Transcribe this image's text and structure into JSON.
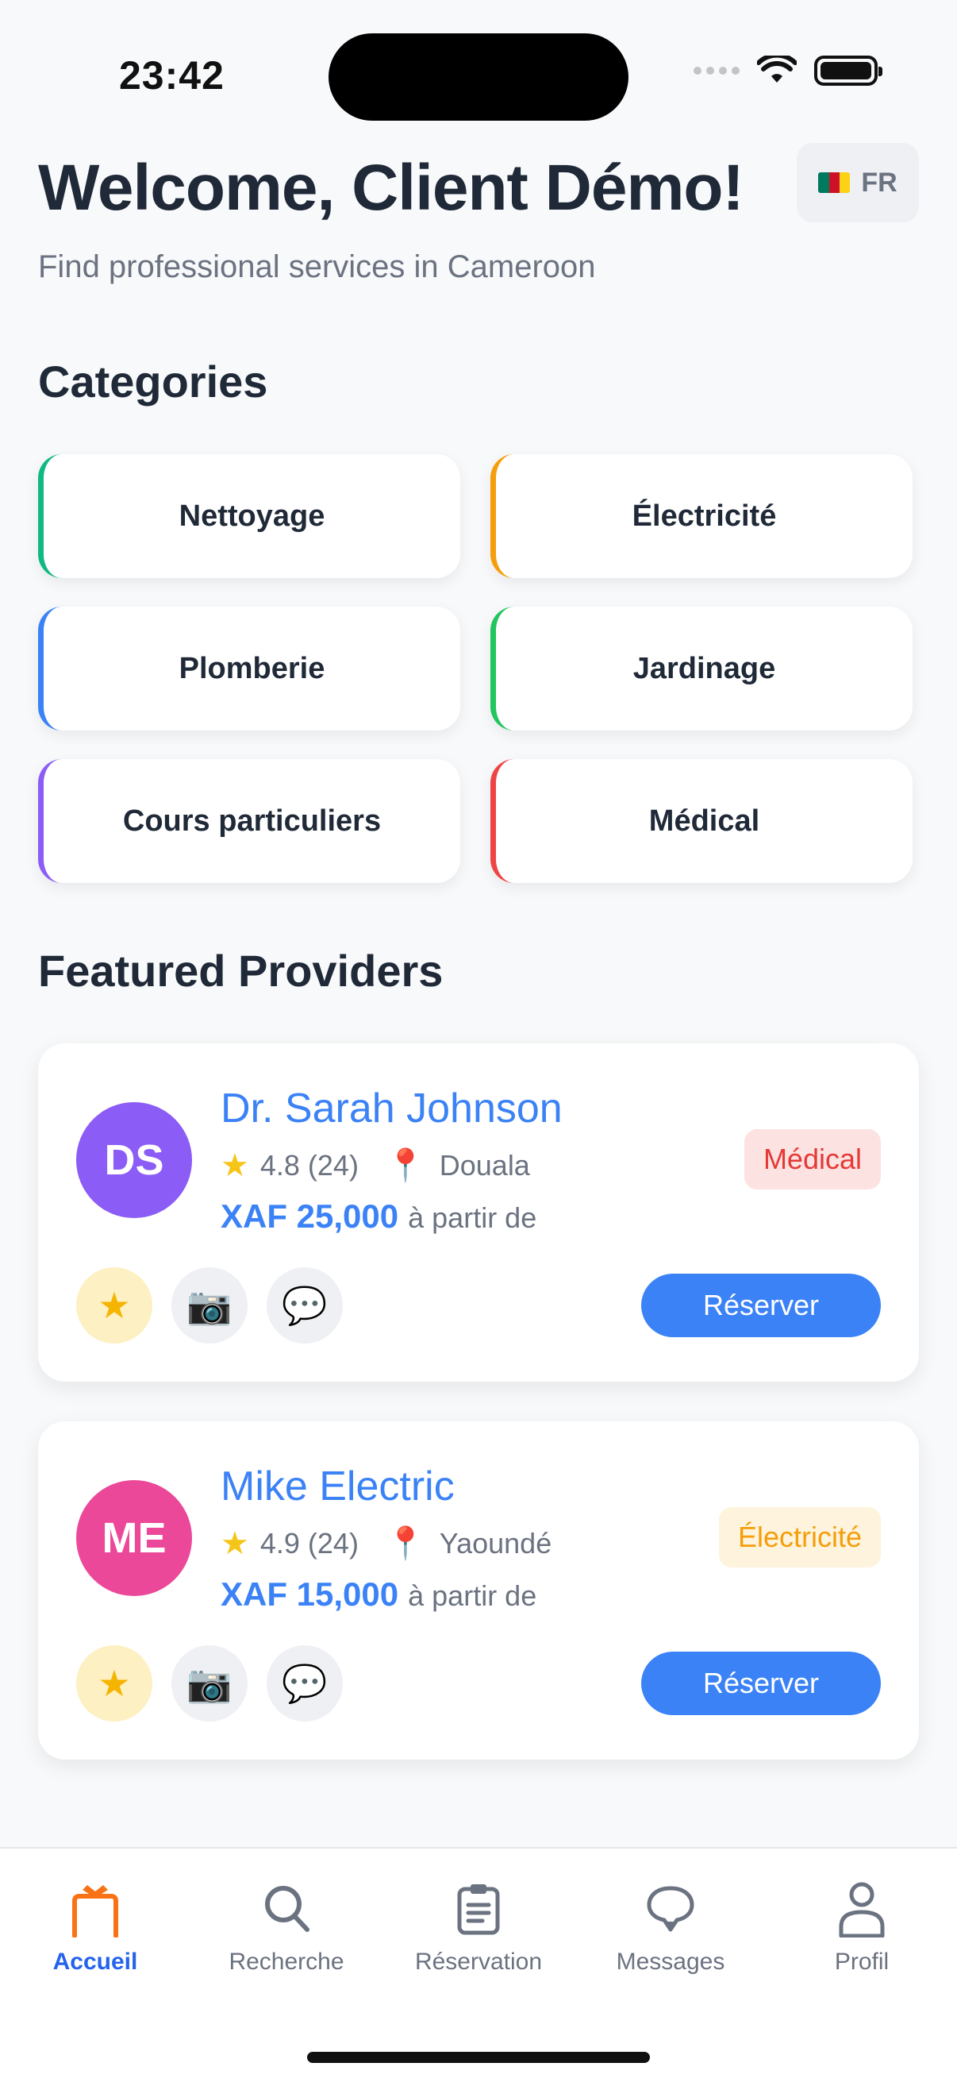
{
  "status_bar": {
    "time": "23:42"
  },
  "header": {
    "welcome": "Welcome, Client Démo!",
    "subtitle": "Find professional services in Cameroon",
    "language": "FR"
  },
  "categories_section": {
    "title": "Categories",
    "items": [
      {
        "label": "Nettoyage",
        "color": "#10b981"
      },
      {
        "label": "Électricité",
        "color": "#f59e0b"
      },
      {
        "label": "Plomberie",
        "color": "#3b82f6"
      },
      {
        "label": "Jardinage",
        "color": "#22c55e"
      },
      {
        "label": "Cours particuliers",
        "color": "#8b5cf6"
      },
      {
        "label": "Médical",
        "color": "#ef4444"
      }
    ]
  },
  "featured_section": {
    "title": "Featured Providers",
    "providers": [
      {
        "initials": "DS",
        "avatar_color": "#8b5cf6",
        "name": "Dr. Sarah Johnson",
        "rating": "4.8 (24)",
        "city": "Douala",
        "price": "XAF 25,000",
        "price_suffix": "à partir de",
        "category": "Médical",
        "badge_bg": "#fde2e2",
        "badge_color": "#e53935",
        "book_label": "Réserver"
      },
      {
        "initials": "ME",
        "avatar_color": "#ec4899",
        "name": "Mike Electric",
        "rating": "4.9 (24)",
        "city": "Yaoundé",
        "price": "XAF 15,000",
        "price_suffix": "à partir de",
        "category": "Électricité",
        "badge_bg": "#fef3dc",
        "badge_color": "#f59e0b",
        "book_label": "Réserver"
      }
    ]
  },
  "tab_bar": {
    "tabs": [
      {
        "label": "Accueil",
        "icon": "home-icon",
        "active": true
      },
      {
        "label": "Recherche",
        "icon": "search-icon",
        "active": false
      },
      {
        "label": "Réservation",
        "icon": "clipboard-icon",
        "active": false
      },
      {
        "label": "Messages",
        "icon": "chat-icon",
        "active": false
      },
      {
        "label": "Profil",
        "icon": "user-icon",
        "active": false
      }
    ]
  },
  "colors": {
    "accent": "#3b82f6",
    "active_tab": "#2563eb",
    "home_icon": "#f97316"
  }
}
